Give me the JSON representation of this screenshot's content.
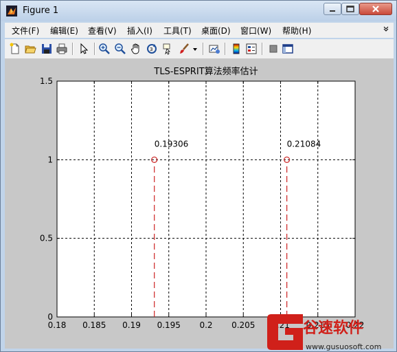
{
  "window": {
    "title": "Figure 1",
    "menu": [
      "文件(F)",
      "编辑(E)",
      "查看(V)",
      "插入(I)",
      "工具(T)",
      "桌面(D)",
      "窗口(W)",
      "帮助(H)"
    ]
  },
  "icons": [
    "new-file-icon",
    "open-folder-icon",
    "save-icon",
    "print-icon",
    "pointer-icon",
    "zoom-in-icon",
    "zoom-out-icon",
    "pan-hand-icon",
    "rotate-3d-icon",
    "data-cursor-icon",
    "brush-icon",
    "brush-dropdown-icon",
    "link-plot-icon",
    "colorbar-icon",
    "legend-icon",
    "hide-plot-tools-icon",
    "show-plot-tools-icon"
  ],
  "chart_data": {
    "type": "stem",
    "title": "TLS-ESPRIT算法频率估计",
    "xlabel": "",
    "ylabel": "",
    "xlim": [
      0.18,
      0.22
    ],
    "ylim": [
      0,
      1.5
    ],
    "xticks": [
      "0.18",
      "0.185",
      "0.19",
      "0.195",
      "0.2",
      "0.205",
      "0.21",
      "0.215",
      "0.22"
    ],
    "yticks": [
      "0",
      "0.5",
      "1",
      "1.5"
    ],
    "grid": true,
    "points": [
      {
        "x": 0.19306,
        "y": 1,
        "label": "0.19306"
      },
      {
        "x": 0.21084,
        "y": 1,
        "label": "0.21084"
      }
    ],
    "color": "#cc2222"
  },
  "watermark": {
    "brand": "谷速软件",
    "url": "www.gusuosoft.com",
    "color": "#d0201a"
  }
}
